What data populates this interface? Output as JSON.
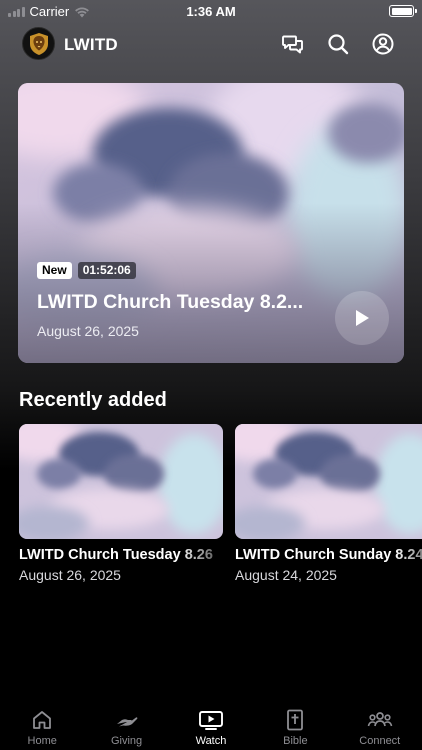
{
  "status_bar": {
    "carrier": "Carrier",
    "time": "1:36 AM"
  },
  "header": {
    "title": "LWITD",
    "icons": [
      "chat-icon",
      "search-icon",
      "profile-icon"
    ]
  },
  "hero": {
    "badge_new": "New",
    "duration": "01:52:06",
    "title": "LWITD Church Tuesday 8.2...",
    "date": "August 26, 2025",
    "play_icon": "play-icon"
  },
  "recently_added": {
    "title": "Recently added",
    "items": [
      {
        "title": "LWITD Church Tuesday 8.26",
        "date": "August 26, 2025"
      },
      {
        "title": "LWITD Church Sunday 8.24",
        "date": "August 24, 2025"
      }
    ]
  },
  "tab_bar": {
    "tabs": [
      {
        "label": "Home",
        "icon": "home-icon"
      },
      {
        "label": "Giving",
        "icon": "giving-hand-icon"
      },
      {
        "label": "Watch",
        "icon": "watch-play-icon"
      },
      {
        "label": "Bible",
        "icon": "bible-icon"
      },
      {
        "label": "Connect",
        "icon": "people-icon"
      }
    ],
    "active": "Watch"
  },
  "colors": {
    "background": "#000000",
    "tab_inactive": "#8e8e93",
    "tab_active": "#ffffff"
  }
}
